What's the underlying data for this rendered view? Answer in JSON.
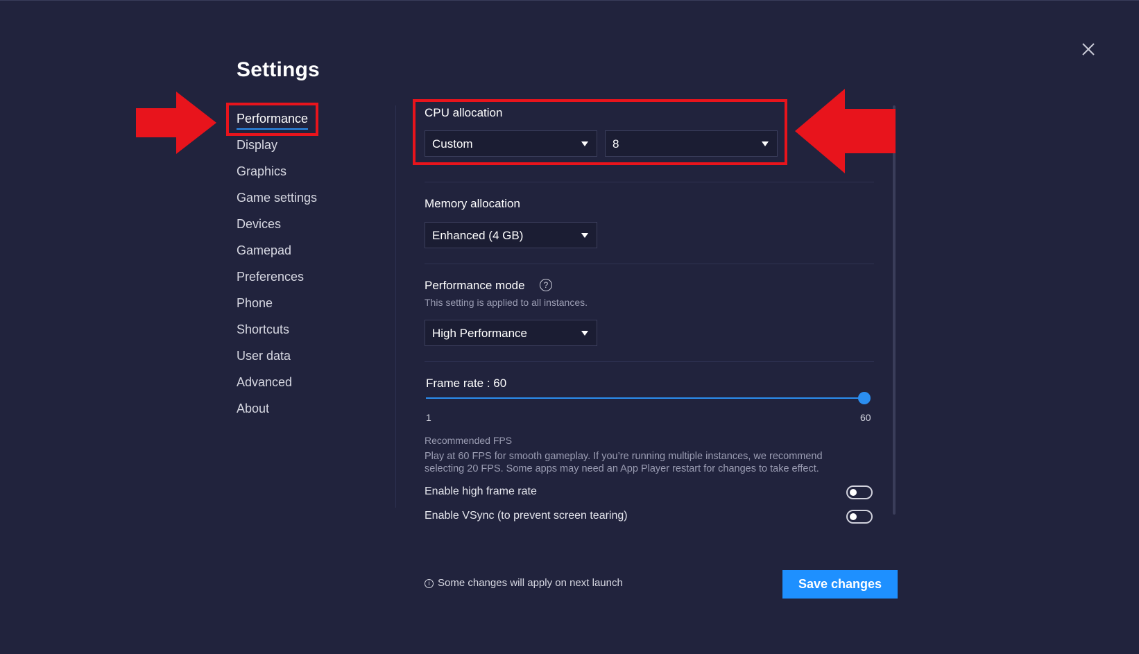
{
  "window": {
    "title": "Settings",
    "close_icon": "close-icon"
  },
  "sidebar": {
    "items": [
      {
        "label": "Performance",
        "active": true
      },
      {
        "label": "Display"
      },
      {
        "label": "Graphics"
      },
      {
        "label": "Game settings"
      },
      {
        "label": "Devices"
      },
      {
        "label": "Gamepad"
      },
      {
        "label": "Preferences"
      },
      {
        "label": "Phone"
      },
      {
        "label": "Shortcuts"
      },
      {
        "label": "User data"
      },
      {
        "label": "Advanced"
      },
      {
        "label": "About"
      }
    ]
  },
  "performance": {
    "cpu": {
      "label": "CPU allocation",
      "mode_value": "Custom",
      "cores_value": "8"
    },
    "memory": {
      "label": "Memory allocation",
      "value": "Enhanced (4 GB)"
    },
    "mode": {
      "label": "Performance mode",
      "help_icon": "question-circle-icon",
      "help_glyph": "?",
      "description": "This setting is applied to all instances.",
      "value": "High Performance"
    },
    "frame_rate": {
      "label": "Frame rate : 60",
      "value": 60,
      "min_label": "1",
      "max_label": "60",
      "recommended_title": "Recommended FPS",
      "recommended_line1": "Play at 60 FPS for smooth gameplay. If you’re running multiple instances, we recommend",
      "recommended_line2": "selecting 20 FPS. Some apps may need an App Player restart for changes to take effect."
    },
    "toggles": {
      "high_frame_rate": {
        "label": "Enable high frame rate",
        "on": false
      },
      "vsync": {
        "label": "Enable VSync (to prevent screen tearing)",
        "on": false
      }
    }
  },
  "footer": {
    "note": "Some changes will apply on next launch",
    "info_glyph": "i",
    "save_label": "Save changes"
  },
  "colors": {
    "background": "#21233d",
    "accent": "#1e90ff",
    "annotation": "#e8141c"
  }
}
